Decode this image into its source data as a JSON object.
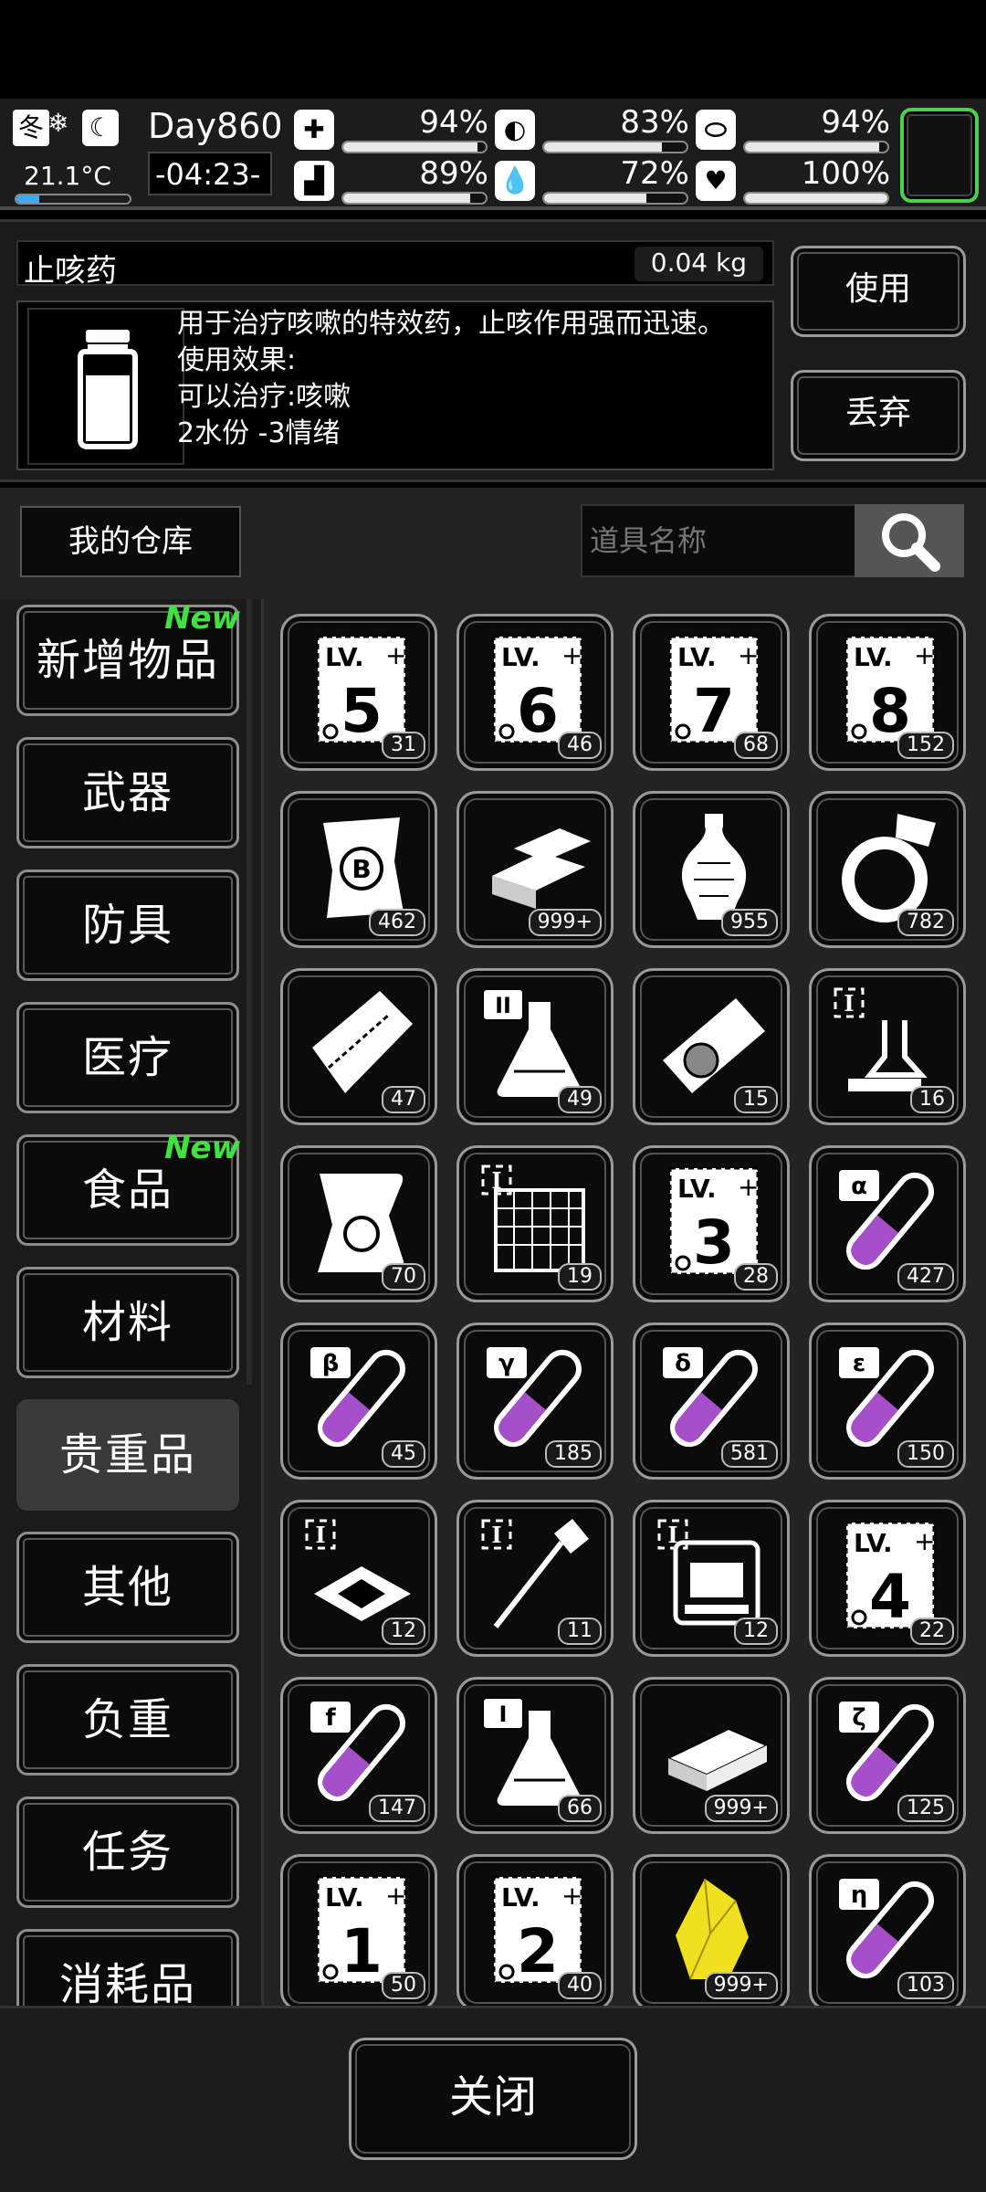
{
  "hud": {
    "season": "冬",
    "temperature": "21.1°C",
    "day": "Day860",
    "time": "-04:23-",
    "stats": [
      {
        "name": "health",
        "icon": "medkit-icon",
        "glyph": "✚",
        "value": "94%",
        "level": 0.94
      },
      {
        "name": "stomach",
        "icon": "stomach-icon",
        "glyph": "◐",
        "value": "83%",
        "level": 0.83
      },
      {
        "name": "pill",
        "icon": "pill-icon",
        "glyph": "⬭",
        "value": "94%",
        "level": 0.94
      },
      {
        "name": "stamina",
        "icon": "boot-icon",
        "glyph": "▟",
        "value": "89%",
        "level": 0.89
      },
      {
        "name": "water",
        "icon": "water-drop-icon",
        "glyph": "💧",
        "value": "72%",
        "level": 0.72
      },
      {
        "name": "mood",
        "icon": "heart-icon",
        "glyph": "♥",
        "value": "100%",
        "level": 1.0
      }
    ]
  },
  "item_detail": {
    "name": "止咳药",
    "weight": "0.04 kg",
    "desc_lines": [
      "用于治疗咳嗽的特效药，止咳作用强而迅速。",
      "使用效果:",
      "可以治疗:咳嗽",
      "2水份 -3情绪"
    ],
    "use_label": "使用",
    "drop_label": "丢弃"
  },
  "warehouse": {
    "title": "我的仓库",
    "search_placeholder": "道具名称"
  },
  "categories": [
    {
      "label": "新增物品",
      "new": "New"
    },
    {
      "label": "武器",
      "new": ""
    },
    {
      "label": "防具",
      "new": ""
    },
    {
      "label": "医疗",
      "new": ""
    },
    {
      "label": "食品",
      "new": "New"
    },
    {
      "label": "材料",
      "new": ""
    },
    {
      "label": "贵重品",
      "new": "",
      "selected": true
    },
    {
      "label": "其他",
      "new": ""
    },
    {
      "label": "负重",
      "new": ""
    },
    {
      "label": "任务",
      "new": ""
    },
    {
      "label": "消耗品",
      "new": ""
    }
  ],
  "items": [
    {
      "icon": "lv-card-icon",
      "text": "5",
      "count": "31"
    },
    {
      "icon": "lv-card-icon",
      "text": "6",
      "count": "46"
    },
    {
      "icon": "lv-card-icon",
      "text": "7",
      "count": "68"
    },
    {
      "icon": "lv-card-icon",
      "text": "8",
      "count": "152"
    },
    {
      "icon": "bitcoin-note-icon",
      "text": "",
      "count": "462"
    },
    {
      "icon": "gold-bars-icon",
      "text": "",
      "count": "999+"
    },
    {
      "icon": "vase-icon",
      "text": "",
      "count": "955"
    },
    {
      "icon": "diamond-ring-icon",
      "text": "",
      "count": "782"
    },
    {
      "icon": "ticket-icon",
      "text": "",
      "count": "47"
    },
    {
      "icon": "flask-icon",
      "text": "II",
      "count": "49"
    },
    {
      "icon": "id-ticket-icon",
      "text": "",
      "count": "15"
    },
    {
      "icon": "lab-equipment-icon",
      "text": "I",
      "count": "16"
    },
    {
      "icon": "scroll-icon",
      "text": "",
      "count": "70"
    },
    {
      "icon": "grid-blueprint-icon",
      "text": "I",
      "count": "19"
    },
    {
      "icon": "lv-card-icon",
      "text": "3",
      "count": "28"
    },
    {
      "icon": "test-tube-icon",
      "text": "α",
      "count": "427"
    },
    {
      "icon": "test-tube-icon",
      "text": "β",
      "count": "45"
    },
    {
      "icon": "test-tube-icon",
      "text": "γ",
      "count": "185"
    },
    {
      "icon": "test-tube-icon",
      "text": "δ",
      "count": "581"
    },
    {
      "icon": "test-tube-icon",
      "text": "ε",
      "count": "150"
    },
    {
      "icon": "chip-icon",
      "text": "I",
      "count": "12"
    },
    {
      "icon": "needle-icon",
      "text": "I",
      "count": "11"
    },
    {
      "icon": "machine-icon",
      "text": "I",
      "count": "12"
    },
    {
      "icon": "lv-card-icon",
      "text": "4",
      "count": "22"
    },
    {
      "icon": "test-tube-icon",
      "text": "f",
      "count": "147"
    },
    {
      "icon": "flask-icon",
      "text": "I",
      "count": "66"
    },
    {
      "icon": "cash-stack-icon",
      "text": "",
      "count": "999+"
    },
    {
      "icon": "test-tube-icon",
      "text": "ζ",
      "count": "125"
    },
    {
      "icon": "lv-card-icon",
      "text": "1",
      "count": "50"
    },
    {
      "icon": "lv-card-icon",
      "text": "2",
      "count": "40"
    },
    {
      "icon": "yellow-crystal-icon",
      "text": "",
      "count": "999+"
    },
    {
      "icon": "test-tube-icon",
      "text": "η",
      "count": "103"
    }
  ],
  "footer": {
    "close_label": "关闭"
  },
  "colors": {
    "new_tag": "#3fe23f",
    "liquid": "#a54fc8",
    "crystal": "#f0e020",
    "selected_slot": "#4bd14b"
  }
}
